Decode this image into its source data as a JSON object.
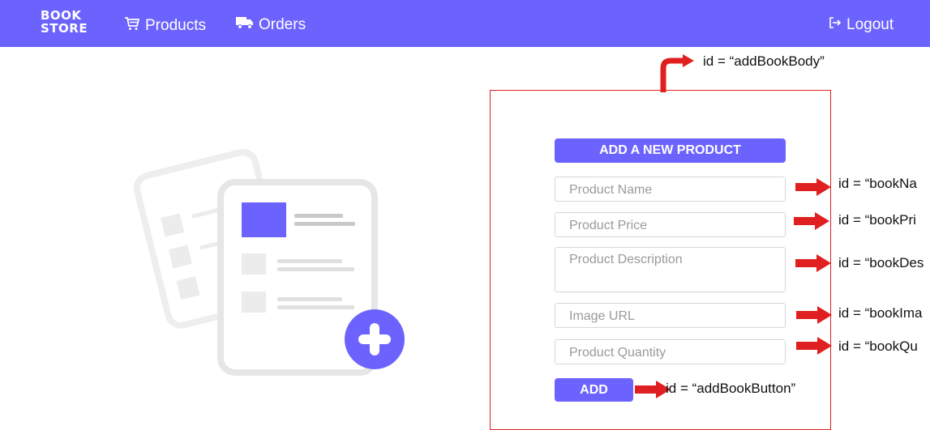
{
  "navbar": {
    "brand_line1": "BOOK",
    "brand_line2": "STORE",
    "products_label": "Products",
    "orders_label": "Orders",
    "logout_label": "Logout",
    "background": "#6c63ff"
  },
  "form": {
    "title": "ADD A NEW PRODUCT",
    "name_placeholder": "Product Name",
    "price_placeholder": "Product Price",
    "description_placeholder": "Product Description",
    "image_placeholder": "Image URL",
    "quantity_placeholder": "Product Quantity",
    "add_label": "ADD"
  },
  "annotations": {
    "body": "id = “addBookBody”",
    "name": "id = “bookNa",
    "price": "id = “bookPri",
    "description": "id = “bookDes",
    "image": "id = “bookIma",
    "quantity": "id = “bookQu",
    "button": "id = “addBookButton”"
  },
  "icons": {
    "products": "cart-icon",
    "orders": "truck-icon",
    "logout": "logout-icon",
    "illustration": "add-document-icon"
  },
  "colors": {
    "accent": "#6c63ff",
    "annotation": "#e02020"
  }
}
